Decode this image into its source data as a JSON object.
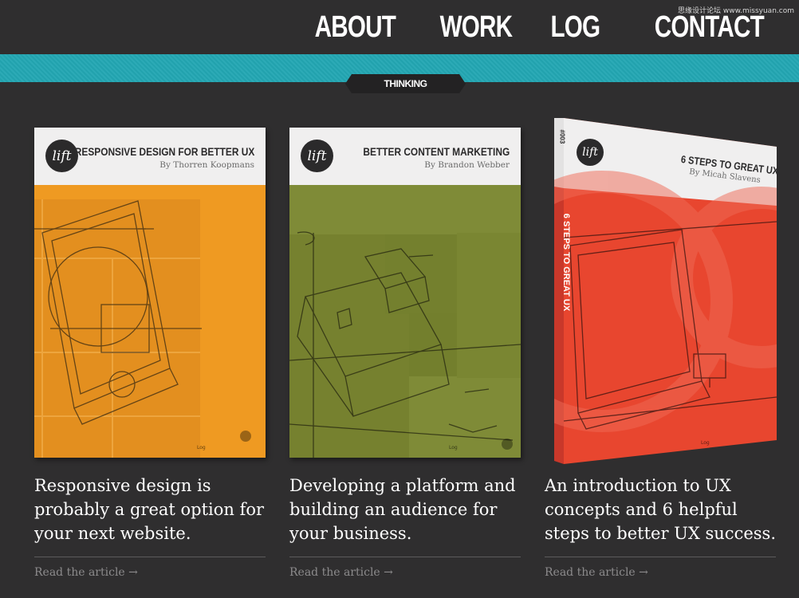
{
  "nav": {
    "items": [
      {
        "label": "ABOUT"
      },
      {
        "label": "WORK"
      },
      {
        "label": "LOG"
      },
      {
        "label": "CONTACT"
      }
    ]
  },
  "watermark": "思缘设计论坛 www.missyuan.com",
  "section": {
    "label": "THINKING"
  },
  "colors": {
    "background": "#2f2e2f",
    "band": "#23a7b3",
    "book1": "#ef9a22",
    "book2": "#7f8b37",
    "book3": "#e8462f"
  },
  "cards": [
    {
      "logo": "lift",
      "book_title": "RESPONSIVE DESIGN FOR BETTER UX",
      "book_author": "By Thorren Koopmans",
      "log_mark": "Log",
      "description": "Responsive design is probably a great option for your next website.",
      "link": "Read the article →"
    },
    {
      "logo": "lift",
      "book_title": "BETTER CONTENT MARKETING",
      "book_author": "By Brandon Webber",
      "log_mark": "Log",
      "description": "Developing a platform and building an audience for your business.",
      "link": "Read the article →"
    },
    {
      "logo": "lift",
      "book_title": "6 STEPS TO GREAT UX",
      "book_author": "By Micah Slavens",
      "spine_title": "6 STEPS TO GREAT UX",
      "spine_issue": "#003",
      "log_mark": "Log",
      "description": "An introduction to UX concepts and 6 helpful steps to better UX success.",
      "link": "Read the article →"
    }
  ]
}
